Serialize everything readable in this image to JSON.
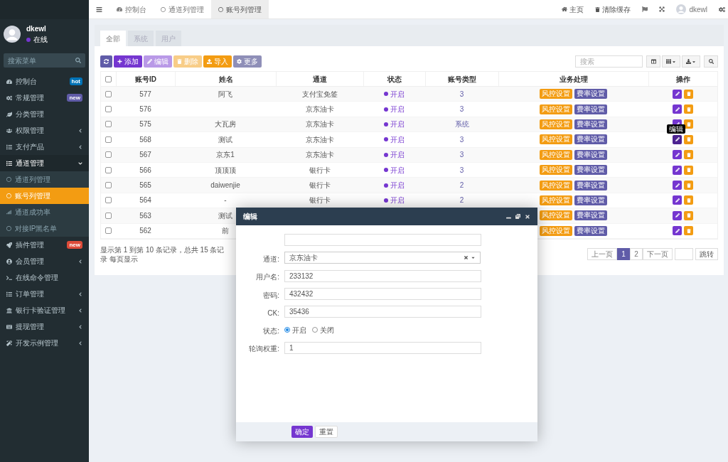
{
  "sidebar": {
    "user": {
      "name": "dkewl",
      "status": "在线"
    },
    "search": {
      "placeholder": "搜索菜单"
    },
    "items": [
      {
        "label": "控制台",
        "badge": {
          "text": "hot",
          "color": "#0073b7"
        }
      },
      {
        "label": "常规管理",
        "badge": {
          "text": "new",
          "color": "#605ca8"
        }
      },
      {
        "label": "分类管理"
      },
      {
        "label": "权限管理",
        "expanded": false
      },
      {
        "label": "支付产品",
        "expanded": false
      },
      {
        "label": "通道管理",
        "expanded": true,
        "children": [
          {
            "label": "通道列管理",
            "selected": false
          },
          {
            "label": "账号列管理",
            "selected": true
          },
          {
            "label": "通道成功率",
            "selected": false
          },
          {
            "label": "对接IP黑名单",
            "selected": false
          }
        ]
      },
      {
        "label": "插件管理",
        "badge": {
          "text": "new",
          "color": "#dd4b39"
        }
      },
      {
        "label": "会员管理",
        "expanded": false
      },
      {
        "label": "在线命令管理"
      },
      {
        "label": "订单管理",
        "expanded": false
      },
      {
        "label": "银行卡验证管理",
        "expanded": false
      },
      {
        "label": "提现管理",
        "expanded": false
      },
      {
        "label": "开发示例管理",
        "expanded": false
      }
    ]
  },
  "header": {
    "tabs": [
      {
        "label": "控制台",
        "selected": false
      },
      {
        "label": "通道列管理",
        "selected": false
      },
      {
        "label": "账号列管理",
        "selected": true
      }
    ],
    "links": [
      "主页",
      "清除缓存"
    ],
    "user": "dkewl"
  },
  "filter_tabs": [
    {
      "label": "全部",
      "selected": true
    },
    {
      "label": "系统",
      "selected": false
    },
    {
      "label": "用户",
      "selected": false
    }
  ],
  "toolbar": [
    {
      "kind": "refresh",
      "disabled": false
    },
    {
      "kind": "add",
      "label": "添加",
      "disabled": false
    },
    {
      "kind": "edit",
      "label": "编辑",
      "disabled": true
    },
    {
      "kind": "delete",
      "label": "删除",
      "disabled": true
    },
    {
      "kind": "import",
      "label": "导入",
      "disabled": false
    },
    {
      "kind": "more",
      "label": "更多",
      "disabled": false
    }
  ],
  "search": {
    "placeholder": "搜索"
  },
  "table": {
    "select_all_checked": false,
    "columns": [
      "账号ID",
      "姓名",
      "通道",
      "状态",
      "账号类型",
      "业务处理",
      "操作"
    ],
    "rows": [
      {
        "id": "577",
        "name": "阿飞",
        "channel": "支付宝免签",
        "status": "开启",
        "type": "3",
        "actions": [
          "风控设置",
          "费率设置"
        ],
        "checked": false
      },
      {
        "id": "576",
        "channel": "京东油卡",
        "status": "开启",
        "type": "3",
        "actions": [
          "风控设置",
          "费率设置"
        ],
        "checked": false
      },
      {
        "id": "575",
        "name": "大瓦房",
        "channel": "京东油卡",
        "status": "开启",
        "type": "系统",
        "actions": [
          "风控设置",
          "费率设置"
        ],
        "checked": false
      },
      {
        "id": "568",
        "name": "测试",
        "channel": "京东油卡",
        "status": "开启",
        "type": "3",
        "actions": [
          "风控设置",
          "费率设置"
        ],
        "checked": false,
        "tooltip": "编辑"
      },
      {
        "id": "567",
        "name": "京东1",
        "channel": "京东油卡",
        "status": "开启",
        "type": "3",
        "actions": [
          "风控设置",
          "费率设置"
        ],
        "checked": false
      },
      {
        "id": "566",
        "name": "顶顶顶",
        "channel": "银行卡",
        "status": "开启",
        "type": "3",
        "actions": [
          "风控设置",
          "费率设置"
        ],
        "checked": false
      },
      {
        "id": "565",
        "name": "daiwenjie",
        "channel": "银行卡",
        "status": "开启",
        "type": "2",
        "actions": [
          "风控设置",
          "费率设置"
        ],
        "checked": false
      },
      {
        "id": "564",
        "name": "-",
        "channel": "银行卡",
        "status": "开启",
        "type": "2",
        "actions": [
          "风控设置",
          "费率设置"
        ],
        "checked": false
      },
      {
        "id": "563",
        "name": "测试",
        "actions": [
          "风控设置",
          "费率设置"
        ],
        "checked": false
      },
      {
        "id": "562",
        "name": "前",
        "actions": [
          "风控设置",
          "费率设置"
        ],
        "checked": false
      }
    ]
  },
  "pagination": {
    "summary": "显示第 1 到第 10 条记录，总共 15 条记录 每页显示",
    "prev": "上一页",
    "pages": [
      {
        "label": "1",
        "selected": true
      },
      {
        "label": "2",
        "selected": false
      }
    ],
    "next": "下一页",
    "go": "跳转"
  },
  "dialog": {
    "title": "编辑",
    "fields": [
      {
        "kind": "text"
      },
      {
        "kind": "select",
        "label": "通道:",
        "value": "京东油卡"
      },
      {
        "kind": "text",
        "label": "用户名:",
        "value": "233132"
      },
      {
        "kind": "text",
        "label": "密码:",
        "value": "432432"
      },
      {
        "kind": "text",
        "label": "CK:",
        "value": "35436"
      },
      {
        "kind": "radio",
        "label": "状态:",
        "options": [
          {
            "label": "开启",
            "selected": true
          },
          {
            "label": "关闭",
            "selected": false
          }
        ]
      },
      {
        "kind": "text",
        "label": "轮询权重:",
        "value": "1"
      }
    ],
    "buttons": [
      {
        "kind": "primary",
        "label": "确定"
      },
      {
        "kind": "default",
        "label": "重置"
      }
    ]
  }
}
